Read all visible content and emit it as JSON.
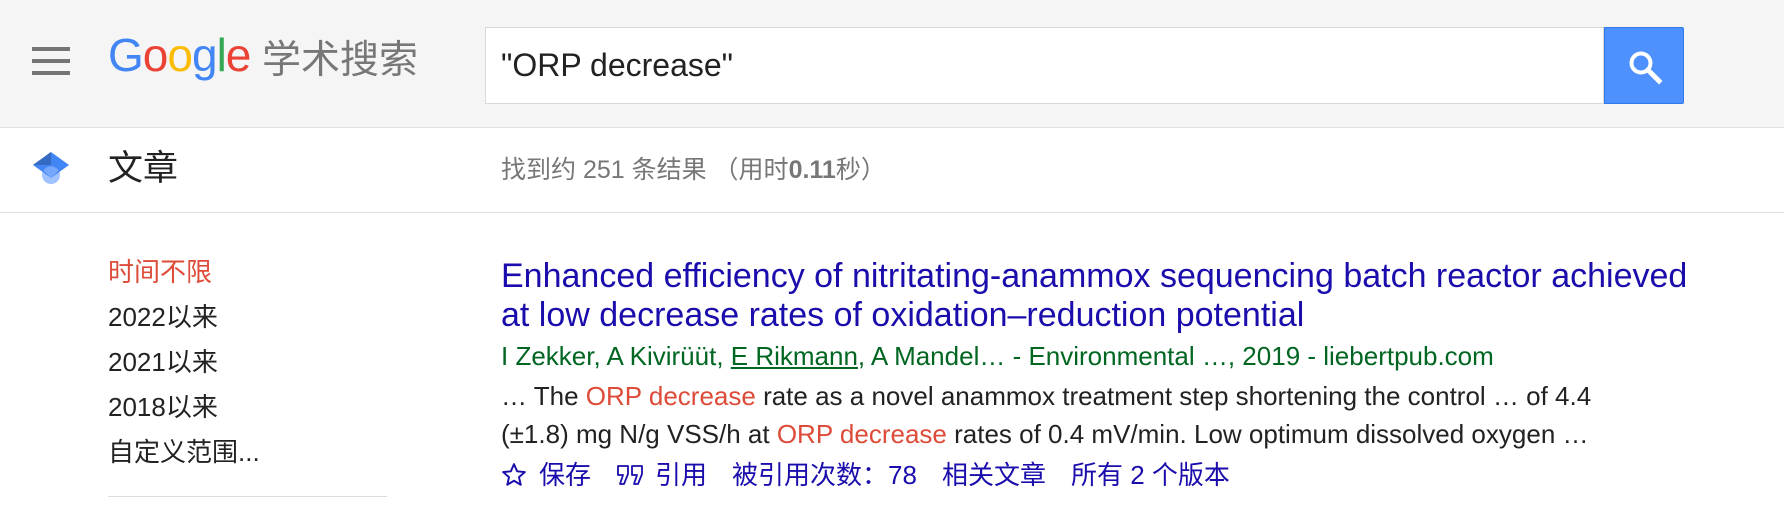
{
  "header": {
    "menu_icon": "hamburger-menu-icon",
    "logo": {
      "letters": [
        {
          "char": "G",
          "color": "#4285f4"
        },
        {
          "char": "o",
          "color": "#ea4335"
        },
        {
          "char": "o",
          "color": "#fbbc05"
        },
        {
          "char": "g",
          "color": "#4285f4"
        },
        {
          "char": "l",
          "color": "#34a853"
        },
        {
          "char": "e",
          "color": "#ea4335"
        }
      ],
      "product_name": "学术搜索"
    },
    "search": {
      "query": "\"ORP decrease\"",
      "button_icon": "search-icon",
      "button_color": "#4d90fe"
    }
  },
  "subbar": {
    "section_icon": "scholar-cap-icon",
    "section_title": "文章",
    "results_stats": {
      "prefix": "找到约 251 条结果 （用时",
      "time": "0.11",
      "suffix": "秒）"
    }
  },
  "sidebar": {
    "time_filters": [
      {
        "label": "时间不限",
        "selected": true
      },
      {
        "label": "2022以来",
        "selected": false
      },
      {
        "label": "2021以来",
        "selected": false
      },
      {
        "label": "2018以来",
        "selected": false
      },
      {
        "label": "自定义范围...",
        "selected": false
      }
    ]
  },
  "results": [
    {
      "title": "Enhanced efficiency of nitritating-anammox sequencing batch reactor achieved at low decrease rates of oxidation–reduction potential",
      "byline": {
        "authors_before_link": "I Zekker, A Kivirüüt, ",
        "linked_author": "E Rikmann",
        "rest": ", A Mandel… - Environmental …, 2019 - liebertpub.com"
      },
      "snippet": [
        {
          "text": "… The ",
          "highlight": false
        },
        {
          "text": "ORP decrease",
          "highlight": true
        },
        {
          "text": " rate as a novel anammox treatment step shortening the control … of 4.4 (±1.8) mg N/g VSS/h at ",
          "highlight": false
        },
        {
          "text": "ORP decrease",
          "highlight": true
        },
        {
          "text": " rates of 0.4 mV/min. Low optimum dissolved oxygen …",
          "highlight": false
        }
      ],
      "actions": {
        "save_icon": "star-icon",
        "save": "保存",
        "cite_icon": "cite-quote-icon",
        "cite": "引用",
        "cited_by": "被引用次数：78",
        "related": "相关文章",
        "versions": "所有 2 个版本"
      }
    }
  ],
  "colors": {
    "title_link": "#1a0dab",
    "byline": "#006621",
    "highlight": "#dd4b39",
    "selected_filter": "#dd4b39"
  }
}
